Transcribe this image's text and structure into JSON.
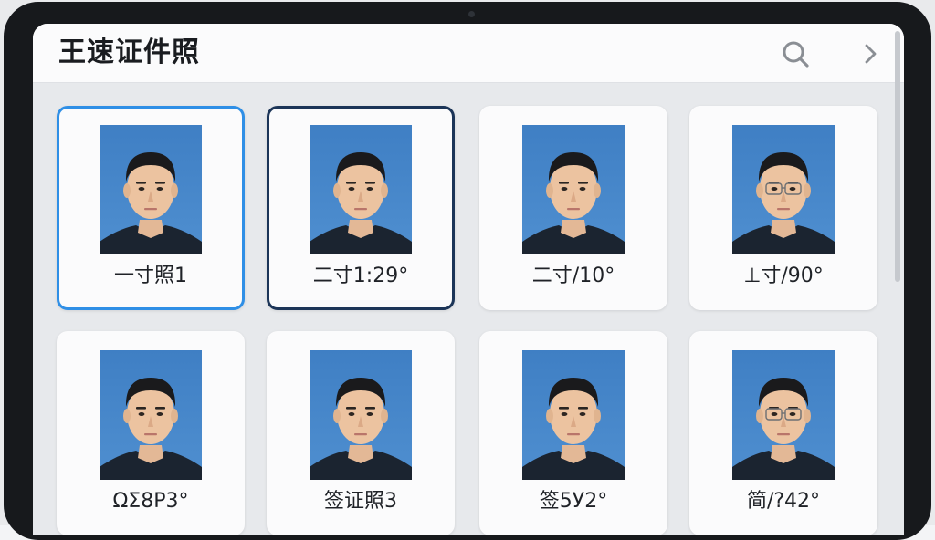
{
  "app": {
    "title": "王速证件照"
  },
  "header": {
    "search_icon": "search-icon",
    "next_icon": "chevron-right-icon"
  },
  "colors": {
    "selected_blue": "#2f8fe6",
    "selected_navy": "#1c3558",
    "photo_background": "#4f8fd0"
  },
  "grid": {
    "items": [
      {
        "label": "一寸照1",
        "state": "selected-blue",
        "glasses": false
      },
      {
        "label": "二寸1:29°",
        "state": "selected-navy",
        "glasses": false
      },
      {
        "label": "二寸/10°",
        "state": "normal",
        "glasses": false
      },
      {
        "label": "⊥寸/90°",
        "state": "normal",
        "glasses": true
      },
      {
        "label": "ΩΣ8Ρ3°",
        "state": "normal",
        "glasses": false
      },
      {
        "label": "签证照3",
        "state": "normal",
        "glasses": false
      },
      {
        "label": "签5У2°",
        "state": "normal",
        "glasses": false
      },
      {
        "label": "简/?42°",
        "state": "normal",
        "glasses": true
      }
    ]
  }
}
